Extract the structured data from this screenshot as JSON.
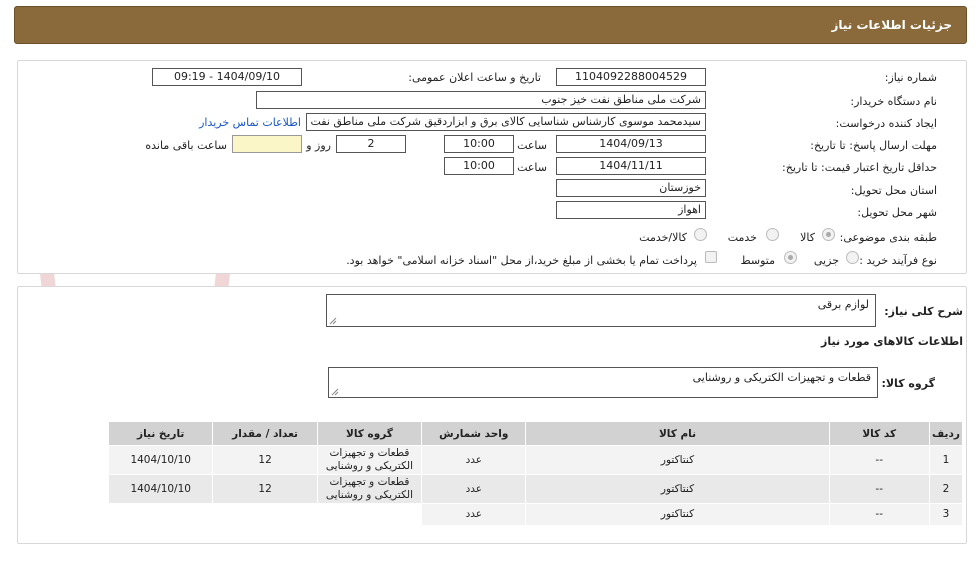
{
  "header": {
    "title": "جزئیات اطلاعات نیاز"
  },
  "form": {
    "need_number_label": "شماره نیاز:",
    "need_number": "1104092288004529",
    "announce_label": "تاریخ و ساعت اعلان عمومی:",
    "announce_value": "1404/09/10 - 09:19",
    "buyer_label": "نام دستگاه خریدار:",
    "buyer_value": "شرکت ملی مناطق نفت خیز جنوب",
    "creator_label": "ایجاد کننده درخواست:",
    "creator_value": "سیدمحمد موسوی کارشناس شناسایی کالای برق و ابزاردقیق شرکت ملی مناطق نفت خیز جنوب",
    "contact_link": "اطلاعات تماس خریدار",
    "reply_deadline_label": "مهلت ارسال پاسخ: تا تاریخ:",
    "reply_date": "1404/09/13",
    "time_label": "ساعت",
    "reply_time": "10:00",
    "days_value": "2",
    "days_label": "روز و",
    "remaining_value": "",
    "remaining_label": "ساعت باقی مانده",
    "price_validity_label": "حداقل تاریخ اعتبار قیمت: تا تاریخ:",
    "price_date": "1404/11/11",
    "price_time": "10:00",
    "province_label": "استان محل تحویل:",
    "province_value": "خوزستان",
    "city_label": "شهر محل تحویل:",
    "city_value": "اهواز",
    "category_label": "طبقه بندی موضوعی:",
    "category_options": [
      "کالا",
      "خدمت",
      "کالا/خدمت"
    ],
    "process_label": "نوع فرآیند خرید :",
    "process_options": [
      "جزیی",
      "متوسط"
    ],
    "payment_note": "پرداخت تمام یا بخشی از مبلغ خرید،از محل \"اسناد خزانه اسلامی\" خواهد بود."
  },
  "summary": {
    "desc_label": "شرح کلی نیاز:",
    "desc_value": "لوازم برقی",
    "goods_info_title": "اطلاعات کالاهای مورد نیاز",
    "group_label": "گروه کالا:",
    "group_value": "قطعات و تجهیزات الکتریکی و روشنایی"
  },
  "table": {
    "headers": [
      "ردیف",
      "کد کالا",
      "نام کالا",
      "واحد شمارش",
      "گروه کالا",
      "تعداد / مقدار",
      "تاریخ نیاز"
    ],
    "rows": [
      {
        "row": "1",
        "code": "--",
        "name": "کنتاکتور",
        "unit": "عدد",
        "group": "قطعات و تجهیزات الکتریکی و روشنایی",
        "qty": "12",
        "date": "1404/10/10"
      },
      {
        "row": "2",
        "code": "--",
        "name": "کنتاکتور",
        "unit": "عدد",
        "group": "قطعات و تجهیزات الکتریکی و روشنایی",
        "qty": "12",
        "date": "1404/10/10"
      },
      {
        "row": "3",
        "code": "--",
        "name": "کنتاکتور",
        "unit": "عدد",
        "group": "",
        "qty": "",
        "date": ""
      }
    ]
  },
  "watermark": {
    "text": "AriaTender.neT"
  }
}
